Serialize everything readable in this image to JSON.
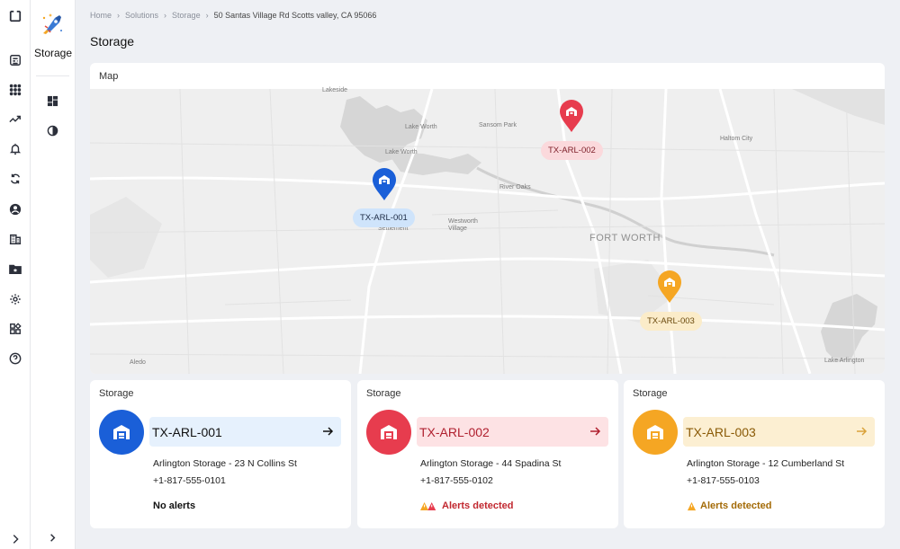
{
  "sidebar": {
    "title": "Storage",
    "icons": [
      "dashboard-icon",
      "apps-grid-icon",
      "trend-icon",
      "bell-alert-icon",
      "sync-icon",
      "user-circle-icon",
      "building-icon",
      "folder-star-icon",
      "settings-gear-icon",
      "widgets-icon",
      "help-icon"
    ],
    "sub_icons": [
      "layout-icon",
      "contrast-icon"
    ]
  },
  "breadcrumb": {
    "items": [
      "Home",
      "Solutions",
      "Storage"
    ],
    "current": "50 Santas Village Rd Scotts valley, CA 95066"
  },
  "page": {
    "title": "Storage"
  },
  "map": {
    "title": "Map",
    "labels": {
      "lakeside": "Lakeside",
      "lake_worth": "Lake Worth",
      "lake_worth_small": "Lake Worth",
      "sansom_park": "Sansom Park",
      "haltom_city": "Haltom City",
      "river_oaks": "River Oaks",
      "westworth_village": "Westworth Village",
      "settlement": "Settlement",
      "fort_worth": "FORT WORTH",
      "aledo": "Aledo",
      "lake_arlington": "Lake Arlington"
    },
    "pins": [
      {
        "id": "TX-ARL-001",
        "status": "ok",
        "color": "#1a5fd8",
        "tag_bg": "#cfe4fb",
        "tag_color": "#1d2b45"
      },
      {
        "id": "TX-ARL-002",
        "status": "alert",
        "color": "#e73c4e",
        "tag_bg": "#fbd9dc",
        "tag_color": "#7d1e28"
      },
      {
        "id": "TX-ARL-003",
        "status": "warning",
        "color": "#f5a623",
        "tag_bg": "#fbecc9",
        "tag_color": "#6b4a0d"
      }
    ]
  },
  "cards": [
    {
      "header": "Storage",
      "code": "TX-ARL-001",
      "address": "Arlington Storage - 23 N Collins St",
      "phone": "+1-817-555-0101",
      "alert": "No alerts",
      "accent": "#1a5fd8",
      "bar_bg": "#e6f1fd",
      "code_color": "#111111",
      "alert_color": "#111111"
    },
    {
      "header": "Storage",
      "code": "TX-ARL-002",
      "address": "Arlington Storage - 44 Spadina St",
      "phone": "+1-817-555-0102",
      "alert": "Alerts detected",
      "accent": "#e73c4e",
      "bar_bg": "#fde2e4",
      "code_color": "#b0202f",
      "alert_color": "#c1272f"
    },
    {
      "header": "Storage",
      "code": "TX-ARL-003",
      "address": "Arlington Storage - 12 Cumberland St",
      "phone": "+1-817-555-0103",
      "alert": "Alerts detected",
      "accent": "#f5a623",
      "bar_bg": "#fcefd2",
      "code_color": "#8a5a06",
      "alert_color": "#a36a06"
    }
  ]
}
